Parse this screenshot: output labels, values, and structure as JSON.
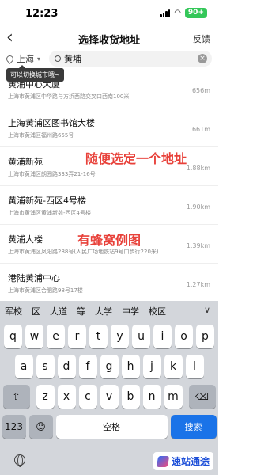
{
  "status": {
    "time": "12:23",
    "battery": "90+"
  },
  "nav": {
    "back": "‹",
    "title": "选择收货地址",
    "feedback": "反馈"
  },
  "search": {
    "city": "上海",
    "query": "黄埔",
    "tooltip": "可以切换城市哦~"
  },
  "results": [
    {
      "name": "黄浦中心大厦",
      "address": "上海市黄浦区中华路与方浜西路交叉口西南100米",
      "distance": "656m"
    },
    {
      "name": "上海黄浦区图书馆大楼",
      "address": "上海市黄浦区福州路655号",
      "distance": "661m"
    },
    {
      "name": "黄浦新苑",
      "address": "上海市黄浦区朗园路333弄21-16号",
      "distance": "1.88km"
    },
    {
      "name": "黄浦新苑-西区4号楼",
      "address": "上海市黄浦区黄浦新苑-西区4号楼",
      "distance": "1.90km"
    },
    {
      "name": "黄浦大楼",
      "address": "上海市黄浦区凤阳路288号(人民广场地铁站9号口步行220米)",
      "distance": "1.39km"
    },
    {
      "name": "港陆黄浦中心",
      "address": "上海市黄浦区合肥路98号17楼",
      "distance": "1.27km"
    }
  ],
  "annotations": {
    "pick": "随便选定一个地址",
    "hive": "有蜂窝例图"
  },
  "keyboard": {
    "candidates": [
      "军校",
      "区",
      "大道",
      "等",
      "大学",
      "中学",
      "校区"
    ],
    "collapse": "∨",
    "row1": [
      "q",
      "w",
      "e",
      "r",
      "t",
      "y",
      "u",
      "i",
      "o",
      "p"
    ],
    "row2": [
      "a",
      "s",
      "d",
      "f",
      "g",
      "h",
      "j",
      "k",
      "l"
    ],
    "row3": [
      "z",
      "x",
      "c",
      "v",
      "b",
      "n",
      "m"
    ],
    "shift": "⇧",
    "delete": "⌫",
    "num": "123",
    "emoji": "☺",
    "space": "空格",
    "search": "搜索"
  },
  "watermark": "速站通途"
}
